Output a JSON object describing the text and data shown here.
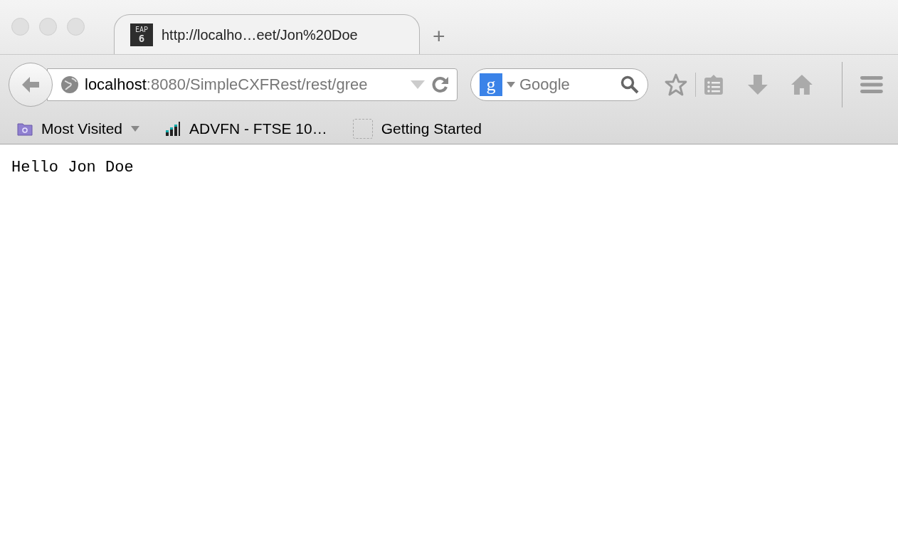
{
  "tabs": [
    {
      "title": "http://localho…eet/Jon%20Doe",
      "icon_text": [
        "EAP",
        "6"
      ],
      "selected": true
    }
  ],
  "new_tab": "+",
  "address_bar": {
    "host": "localhost",
    "rest": ":8080/SimpleCXFRest/rest/gree"
  },
  "search": {
    "engine_letter": "g",
    "placeholder": "Google"
  },
  "bookmarks": [
    {
      "label": "Most Visited",
      "kind": "folder"
    },
    {
      "label": "ADVFN - FTSE 10…",
      "kind": "chart"
    },
    {
      "label": "Getting Started",
      "kind": "blank"
    }
  ],
  "page": {
    "text": "Hello Jon Doe"
  }
}
